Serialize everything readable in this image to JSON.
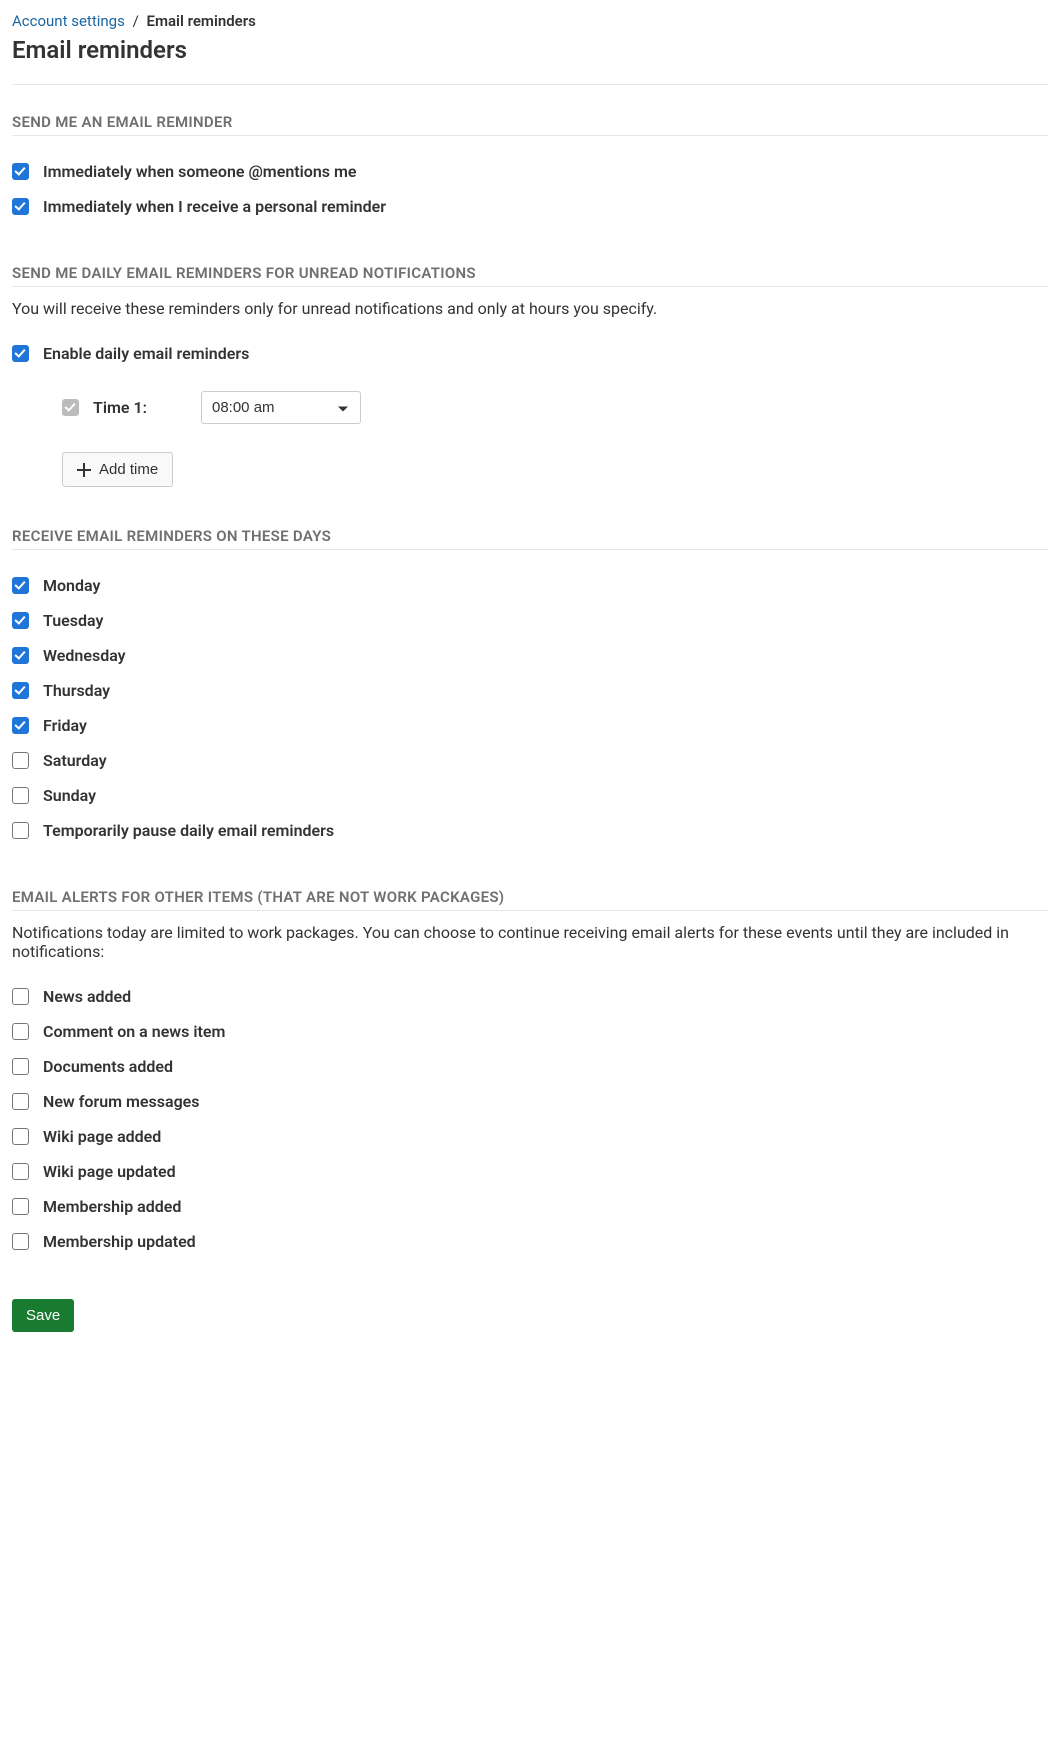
{
  "breadcrumb": {
    "parent": "Account settings",
    "current": "Email reminders"
  },
  "page_title": "Email reminders",
  "section_immediate": {
    "heading": "SEND ME AN EMAIL REMINDER",
    "items": [
      {
        "label": "Immediately when someone @mentions me",
        "checked": true
      },
      {
        "label": "Immediately when I receive a personal reminder",
        "checked": true
      }
    ]
  },
  "section_daily": {
    "heading": "SEND ME DAILY EMAIL REMINDERS FOR UNREAD NOTIFICATIONS",
    "desc": "You will receive these reminders only for unread notifications and only at hours you specify.",
    "enable": {
      "label": "Enable daily email reminders",
      "checked": true
    },
    "time1": {
      "label": "Time 1:",
      "value": "08:00 am",
      "checked": true,
      "disabled": true
    },
    "add_time_label": "Add time"
  },
  "section_days": {
    "heading": "RECEIVE EMAIL REMINDERS ON THESE DAYS",
    "items": [
      {
        "label": "Monday",
        "checked": true
      },
      {
        "label": "Tuesday",
        "checked": true
      },
      {
        "label": "Wednesday",
        "checked": true
      },
      {
        "label": "Thursday",
        "checked": true
      },
      {
        "label": "Friday",
        "checked": true
      },
      {
        "label": "Saturday",
        "checked": false
      },
      {
        "label": "Sunday",
        "checked": false
      },
      {
        "label": "Temporarily pause daily email reminders",
        "checked": false
      }
    ]
  },
  "section_alerts": {
    "heading": "EMAIL ALERTS FOR OTHER ITEMS (THAT ARE NOT WORK PACKAGES)",
    "desc": "Notifications today are limited to work packages. You can choose to continue receiving email alerts for these events until they are included in notifications:",
    "items": [
      {
        "label": "News added",
        "checked": false
      },
      {
        "label": "Comment on a news item",
        "checked": false
      },
      {
        "label": "Documents added",
        "checked": false
      },
      {
        "label": "New forum messages",
        "checked": false
      },
      {
        "label": "Wiki page added",
        "checked": false
      },
      {
        "label": "Wiki page updated",
        "checked": false
      },
      {
        "label": "Membership added",
        "checked": false
      },
      {
        "label": "Membership updated",
        "checked": false
      }
    ]
  },
  "save_label": "Save"
}
